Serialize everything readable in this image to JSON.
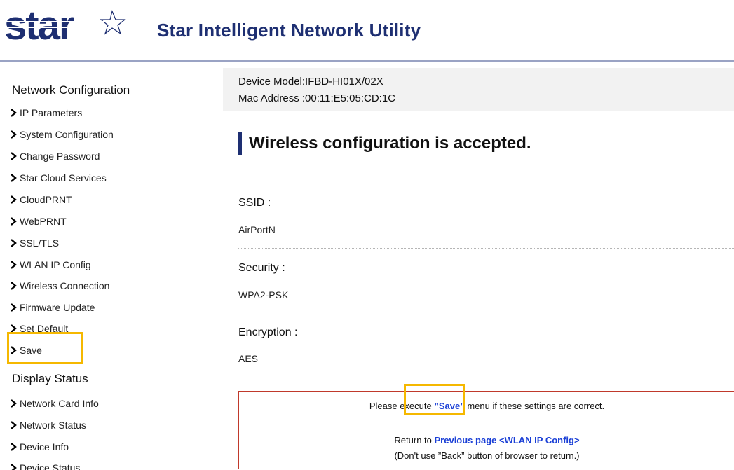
{
  "header": {
    "logo_text": "star",
    "title": "Star Intelligent Network Utility"
  },
  "sidebar": {
    "network_configuration_title": "Network Configuration",
    "network_items": [
      {
        "label": "IP Parameters"
      },
      {
        "label": "System Configuration"
      },
      {
        "label": "Change Password"
      },
      {
        "label": "Star Cloud Services"
      },
      {
        "label": "CloudPRNT"
      },
      {
        "label": "WebPRNT"
      },
      {
        "label": "SSL/TLS"
      },
      {
        "label": "WLAN IP Config"
      },
      {
        "label": "Wireless Connection"
      },
      {
        "label": "Firmware Update"
      },
      {
        "label": "Set Default"
      },
      {
        "label": "Save"
      }
    ],
    "display_status_title": "Display Status",
    "status_items": [
      {
        "label": "Network Card Info"
      },
      {
        "label": "Network Status"
      },
      {
        "label": "Device Info"
      },
      {
        "label": "Device Status"
      }
    ]
  },
  "main": {
    "device_model": "Device Model:IFBD-HI01X/02X",
    "mac_address": "Mac Address :00:11:E5:05:CD:1C",
    "heading": "Wireless configuration is accepted.",
    "fields": [
      {
        "label": "SSID :",
        "value": "AirPortN"
      },
      {
        "label": "Security :",
        "value": "WPA2-PSK"
      },
      {
        "label": "Encryption :",
        "value": "AES"
      }
    ],
    "notice": {
      "line1_before": "Please execute ",
      "line1_link": "”Save”",
      "line1_after": " menu if these settings are correct.",
      "line2_before": "Return to ",
      "line2_link": "Previous page <WLAN IP Config>",
      "line3": "(Don't use ”Back” button of browser to return.)"
    }
  },
  "colors": {
    "brand_navy": "#1e2f72",
    "link_blue": "#1a3fd6",
    "highlight_yellow": "#f5b800",
    "notice_border_red": "#c0392b"
  }
}
